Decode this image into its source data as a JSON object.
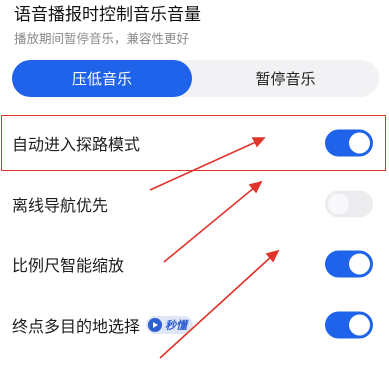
{
  "header": {
    "title": "语音播报时控制音乐音量",
    "subtitle": "播放期间暂停音乐，兼容性更好"
  },
  "segmented": {
    "options": [
      {
        "label": "压低音乐",
        "selected": true
      },
      {
        "label": "暂停音乐",
        "selected": false
      }
    ]
  },
  "settings": [
    {
      "label": "自动进入探路模式",
      "enabled": true
    },
    {
      "label": "离线导航优先",
      "enabled": false
    },
    {
      "label": "比例尺智能缩放",
      "enabled": true
    },
    {
      "label": "终点多目的地选择",
      "enabled": true,
      "badge": "秒懂",
      "badge_icon": "play-icon"
    }
  ],
  "colors": {
    "accent": "#1e63ea",
    "annotation": "#e0342b"
  }
}
